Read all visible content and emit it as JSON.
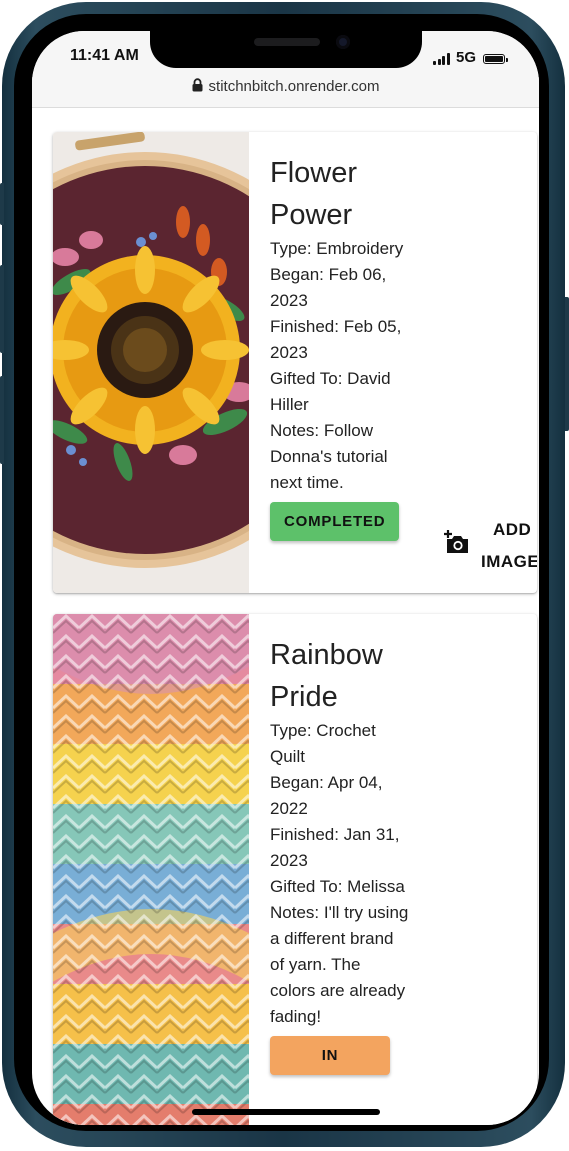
{
  "status_bar": {
    "time": "11:41 AM",
    "network": "5G"
  },
  "browser": {
    "url": "stitchnbitch.onrender.com"
  },
  "projects": [
    {
      "title": "Flower Power",
      "type": "Type: Embroidery",
      "began": "Began: Feb 06, 2023",
      "finished": "Finished: Feb 05, 2023",
      "gifted_to": "Gifted To: David Hiller",
      "notes": "Notes: Follow Donna's tutorial next time.",
      "status": "COMPLETED",
      "add_image_label_1": "ADD",
      "add_image_label_2": "IMAGE",
      "image_icon": "sunflower-embroidery-hoop-photo"
    },
    {
      "title": "Rainbow Pride",
      "type": "Type: Crochet Quilt",
      "began": "Began: Apr 04, 2022",
      "finished": "Finished: Jan 31, 2023",
      "gifted_to": "Gifted To: Melissa",
      "notes": "Notes: I'll try using a different brand of yarn. The colors are already fading!",
      "status": "IN",
      "image_icon": "rainbow-crochet-blanket-photo"
    }
  ],
  "colors": {
    "completed": "#5dc16a",
    "in_progress": "#f3a45f",
    "frame": "#1e3a49"
  }
}
